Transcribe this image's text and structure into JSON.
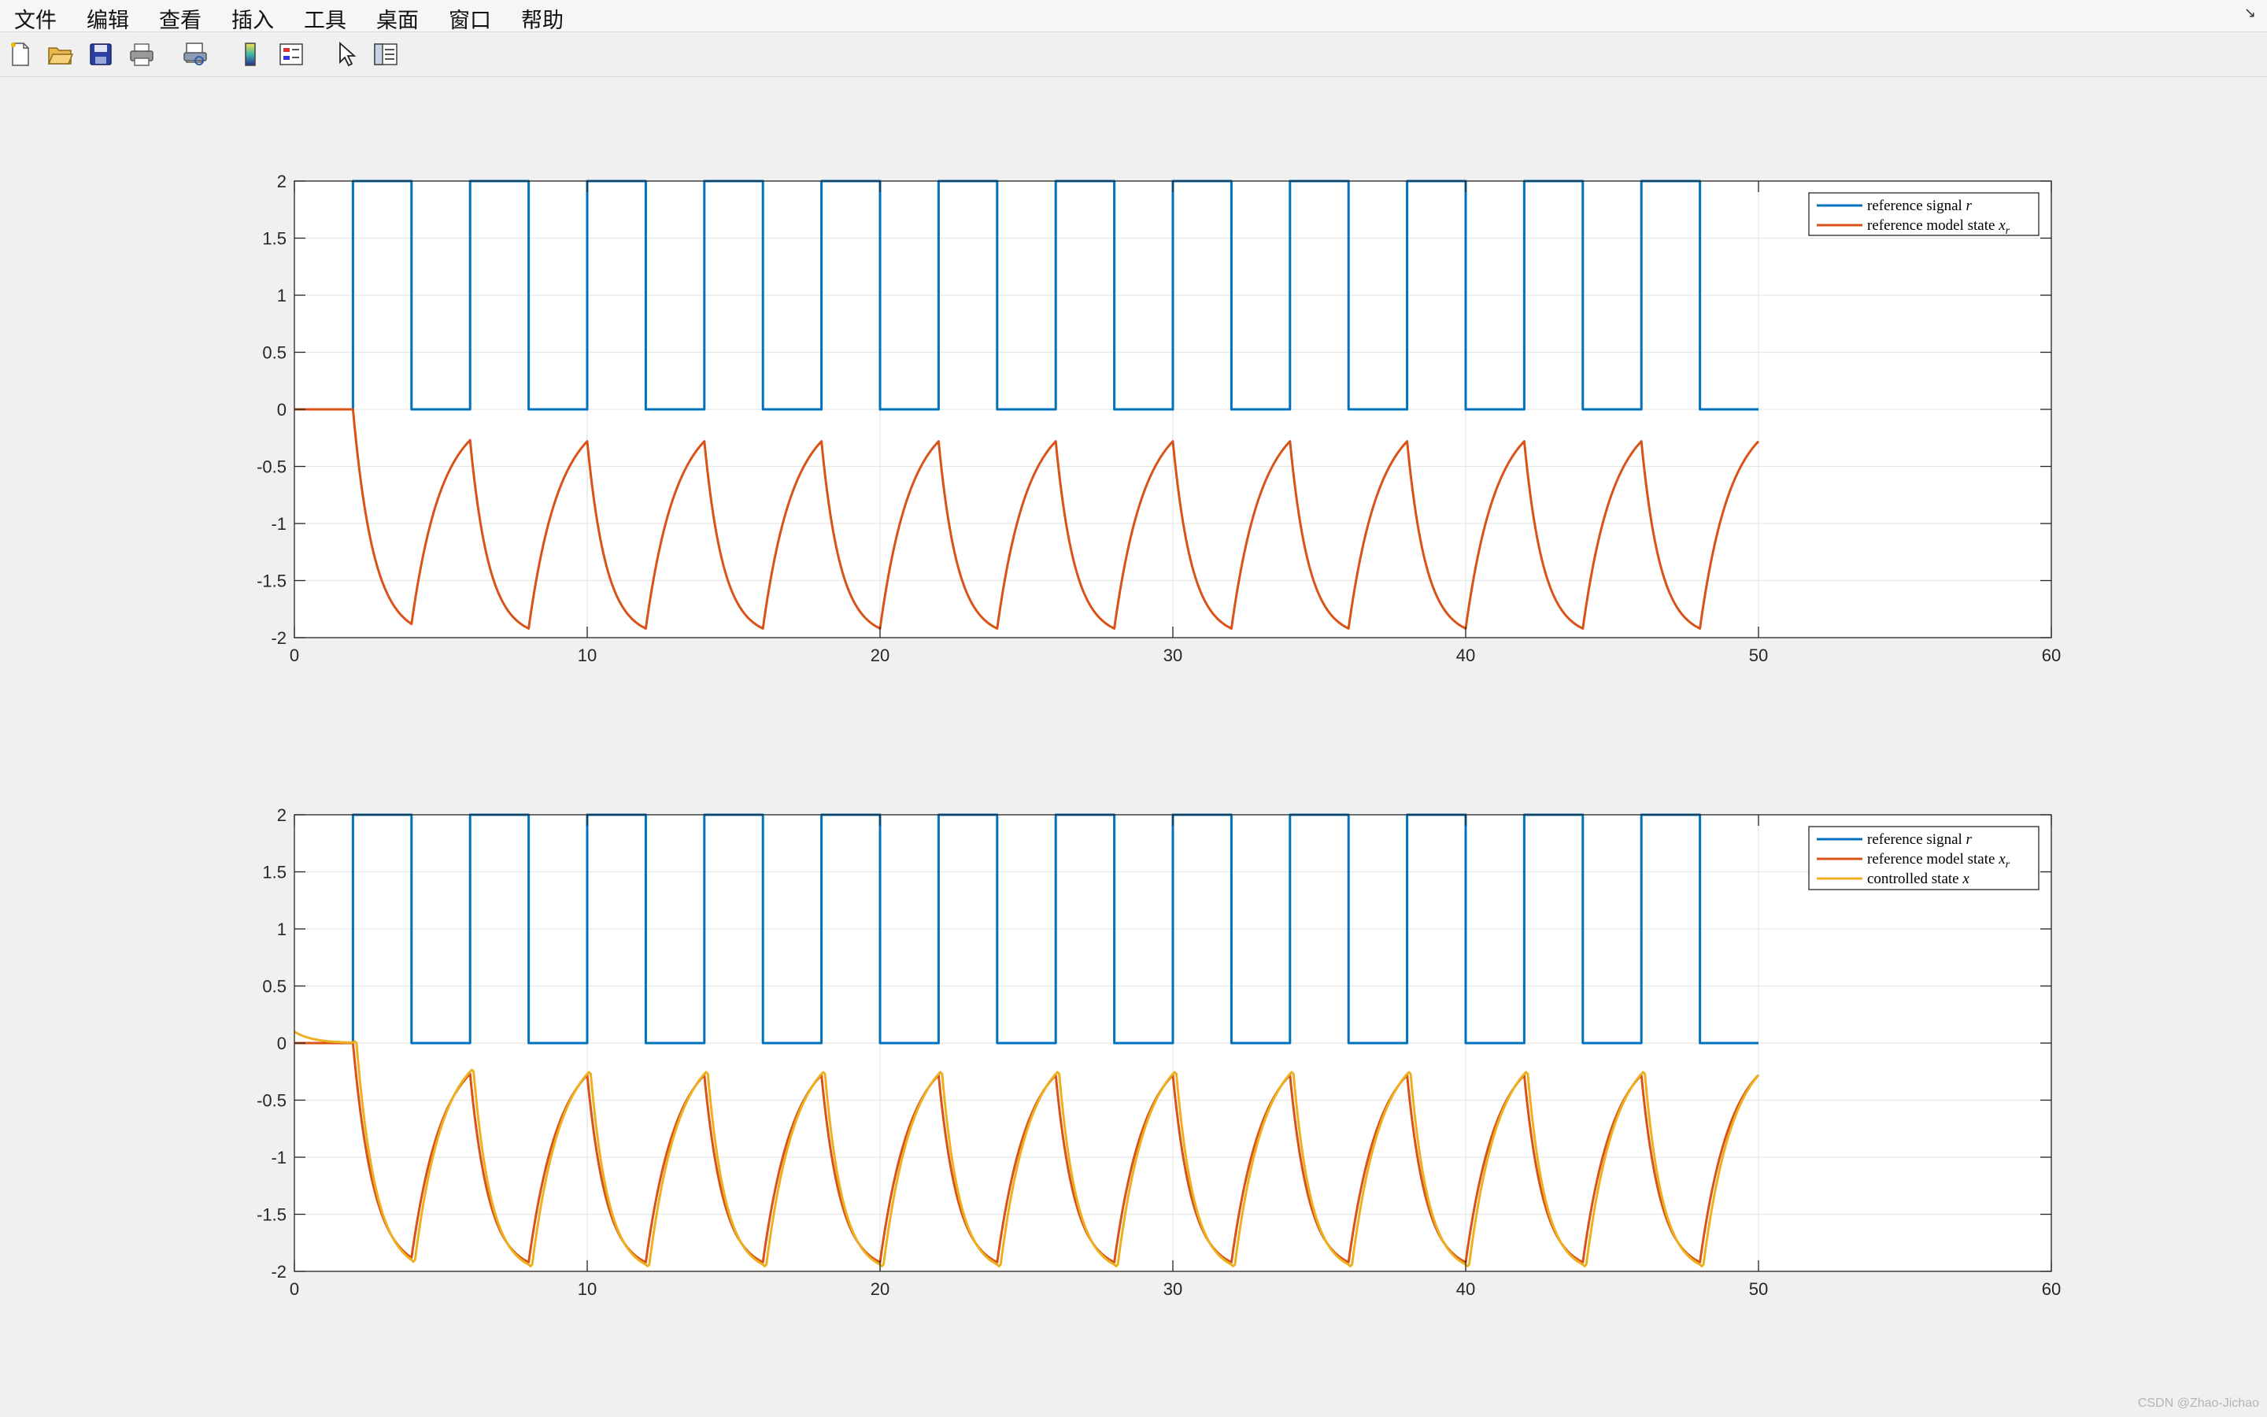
{
  "menu": [
    "文件",
    "编辑",
    "查看",
    "插入",
    "工具",
    "桌面",
    "窗口",
    "帮助"
  ],
  "undock_glyph": "↘",
  "toolbar": [
    "new-file-icon",
    "open-folder-icon",
    "save-icon",
    "print-icon",
    "print-preview-icon",
    "colorbar-icon",
    "legend-icon",
    "pointer-icon",
    "property-editor-icon"
  ],
  "credit": "CSDN @Zhao-Jichao",
  "colors": {
    "reference": "#0072BD",
    "model": "#D95319",
    "controlled": "#EDB120"
  },
  "chart_data": [
    {
      "type": "line",
      "xlim": [
        0,
        60
      ],
      "ylim": [
        -2,
        2
      ],
      "xticks": [
        0,
        10,
        20,
        30,
        40,
        50,
        60
      ],
      "yticks": [
        2,
        1.5,
        1,
        0.5,
        0,
        -0.5,
        -1,
        -1.5,
        -2
      ],
      "xtick_labels": [
        "0",
        "10",
        "20",
        "30",
        "40",
        "50",
        "60"
      ],
      "ytick_labels": [
        "2",
        "1.5",
        "1",
        "0.5",
        "0",
        "-0.5",
        "-1",
        "-1.5",
        "-2"
      ],
      "grid": true,
      "legend_position": "top-right",
      "t_end": 50,
      "series": [
        {
          "name": "reference signal r",
          "legend": [
            "reference signal ",
            "r",
            ""
          ],
          "color": "#0072BD",
          "kind": "square",
          "x": [
            0,
            2,
            2,
            4,
            4,
            6,
            6,
            8,
            8,
            10,
            10,
            12,
            12,
            14,
            14,
            16,
            16,
            18,
            18,
            20,
            20,
            22,
            22,
            24,
            24,
            26,
            26,
            28,
            28,
            30,
            30,
            32,
            32,
            34,
            34,
            36,
            36,
            38,
            38,
            40,
            40,
            42,
            42,
            44,
            44,
            46,
            46,
            48,
            48,
            50
          ],
          "y": [
            0,
            0,
            2,
            2,
            0,
            0,
            2,
            2,
            0,
            0,
            2,
            2,
            0,
            0,
            2,
            2,
            0,
            0,
            2,
            2,
            0,
            0,
            2,
            2,
            0,
            0,
            2,
            2,
            0,
            0,
            2,
            2,
            0,
            0,
            2,
            2,
            0,
            0,
            2,
            2,
            0,
            0,
            2,
            2,
            0,
            0,
            2,
            2,
            0,
            0
          ]
        },
        {
          "name": "reference model state x_r",
          "legend": [
            "reference model state ",
            "x",
            "r"
          ],
          "color": "#D95319",
          "kind": "model",
          "peaks": [
            [
              0,
              0
            ],
            [
              2,
              0
            ],
            [
              4,
              -1.88
            ],
            [
              6,
              -0.27
            ],
            [
              8,
              -1.92
            ],
            [
              10,
              -0.28
            ],
            [
              12,
              -1.92
            ],
            [
              14,
              -0.28
            ],
            [
              16,
              -1.92
            ],
            [
              18,
              -0.28
            ],
            [
              20,
              -1.92
            ],
            [
              22,
              -0.28
            ],
            [
              24,
              -1.92
            ],
            [
              26,
              -0.28
            ],
            [
              28,
              -1.92
            ],
            [
              30,
              -0.28
            ],
            [
              32,
              -1.92
            ],
            [
              34,
              -0.28
            ],
            [
              36,
              -1.92
            ],
            [
              38,
              -0.28
            ],
            [
              40,
              -1.92
            ],
            [
              42,
              -0.28
            ],
            [
              44,
              -1.92
            ],
            [
              46,
              -0.28
            ],
            [
              48,
              -1.92
            ],
            [
              50,
              -0.28
            ]
          ]
        }
      ]
    },
    {
      "type": "line",
      "xlim": [
        0,
        60
      ],
      "ylim": [
        -2,
        2
      ],
      "xticks": [
        0,
        10,
        20,
        30,
        40,
        50,
        60
      ],
      "yticks": [
        2,
        1.5,
        1,
        0.5,
        0,
        -0.5,
        -1,
        -1.5,
        -2
      ],
      "xtick_labels": [
        "0",
        "10",
        "20",
        "30",
        "40",
        "50",
        "60"
      ],
      "ytick_labels": [
        "2",
        "1.5",
        "1",
        "0.5",
        "0",
        "-0.5",
        "-1",
        "-1.5",
        "-2"
      ],
      "grid": true,
      "legend_position": "top-right",
      "t_end": 50,
      "series": [
        {
          "name": "reference signal r",
          "legend": [
            "reference signal ",
            "r",
            ""
          ],
          "color": "#0072BD",
          "kind": "square",
          "x": [
            0,
            2,
            2,
            4,
            4,
            6,
            6,
            8,
            8,
            10,
            10,
            12,
            12,
            14,
            14,
            16,
            16,
            18,
            18,
            20,
            20,
            22,
            22,
            24,
            24,
            26,
            26,
            28,
            28,
            30,
            30,
            32,
            32,
            34,
            34,
            36,
            36,
            38,
            38,
            40,
            40,
            42,
            42,
            44,
            44,
            46,
            46,
            48,
            48,
            50
          ],
          "y": [
            0,
            0,
            2,
            2,
            0,
            0,
            2,
            2,
            0,
            0,
            2,
            2,
            0,
            0,
            2,
            2,
            0,
            0,
            2,
            2,
            0,
            0,
            2,
            2,
            0,
            0,
            2,
            2,
            0,
            0,
            2,
            2,
            0,
            0,
            2,
            2,
            0,
            0,
            2,
            2,
            0,
            0,
            2,
            2,
            0,
            0,
            2,
            2,
            0,
            0
          ]
        },
        {
          "name": "reference model state x_r",
          "legend": [
            "reference model state ",
            "x",
            "r"
          ],
          "color": "#D95319",
          "kind": "model",
          "peaks": [
            [
              0,
              0
            ],
            [
              2,
              0
            ],
            [
              4,
              -1.88
            ],
            [
              6,
              -0.27
            ],
            [
              8,
              -1.92
            ],
            [
              10,
              -0.28
            ],
            [
              12,
              -1.92
            ],
            [
              14,
              -0.28
            ],
            [
              16,
              -1.92
            ],
            [
              18,
              -0.28
            ],
            [
              20,
              -1.92
            ],
            [
              22,
              -0.28
            ],
            [
              24,
              -1.92
            ],
            [
              26,
              -0.28
            ],
            [
              28,
              -1.92
            ],
            [
              30,
              -0.28
            ],
            [
              32,
              -1.92
            ],
            [
              34,
              -0.28
            ],
            [
              36,
              -1.92
            ],
            [
              38,
              -0.28
            ],
            [
              40,
              -1.92
            ],
            [
              42,
              -0.28
            ],
            [
              44,
              -1.92
            ],
            [
              46,
              -0.28
            ],
            [
              48,
              -1.92
            ],
            [
              50,
              -0.28
            ]
          ]
        },
        {
          "name": "controlled state x",
          "legend": [
            "controlled state ",
            "x",
            ""
          ],
          "color": "#EDB120",
          "kind": "controlled",
          "initial": 0.1,
          "lag": 0.12,
          "peaks": [
            [
              0,
              0.1
            ],
            [
              2,
              0
            ],
            [
              4,
              -1.9
            ],
            [
              6,
              -0.25
            ],
            [
              8,
              -1.94
            ],
            [
              10,
              -0.27
            ],
            [
              12,
              -1.94
            ],
            [
              14,
              -0.27
            ],
            [
              16,
              -1.94
            ],
            [
              18,
              -0.27
            ],
            [
              20,
              -1.94
            ],
            [
              22,
              -0.27
            ],
            [
              24,
              -1.94
            ],
            [
              26,
              -0.27
            ],
            [
              28,
              -1.94
            ],
            [
              30,
              -0.27
            ],
            [
              32,
              -1.94
            ],
            [
              34,
              -0.27
            ],
            [
              36,
              -1.94
            ],
            [
              38,
              -0.27
            ],
            [
              40,
              -1.94
            ],
            [
              42,
              -0.27
            ],
            [
              44,
              -1.94
            ],
            [
              46,
              -0.27
            ],
            [
              48,
              -1.94
            ],
            [
              50,
              -0.28
            ]
          ]
        }
      ]
    }
  ]
}
